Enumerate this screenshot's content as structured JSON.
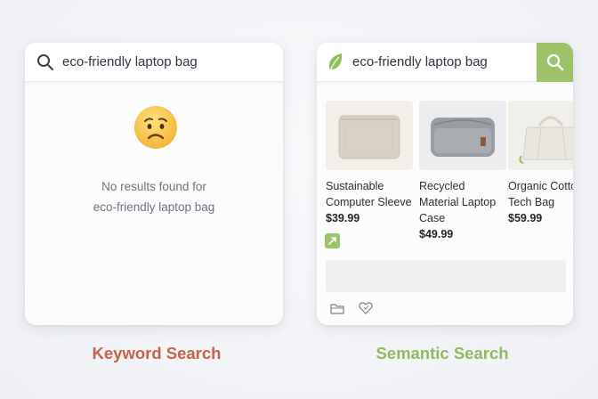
{
  "keyword_panel": {
    "query": "eco-friendly laptop bag",
    "empty_line1": "No results found for",
    "empty_line2": "eco-friendly laptop bag",
    "caption": "Keyword Search"
  },
  "semantic_panel": {
    "query": "eco-friendly laptop bag",
    "caption": "Semantic Search",
    "products": [
      {
        "name": "Sustainable Computer Sleeve",
        "price": "$39.99"
      },
      {
        "name": "Recycled Material Laptop Case",
        "price": "$49.99"
      },
      {
        "name": "Organic Cotton Tech Bag",
        "price": "$59.99"
      }
    ]
  },
  "colors": {
    "keyword_accent": "#c8614b",
    "semantic_accent": "#9cc36a"
  },
  "icons": [
    "search-icon",
    "sad-face-emoji",
    "leaf-icon",
    "eco-badge-icon",
    "folder-icon",
    "heart-icon"
  ]
}
